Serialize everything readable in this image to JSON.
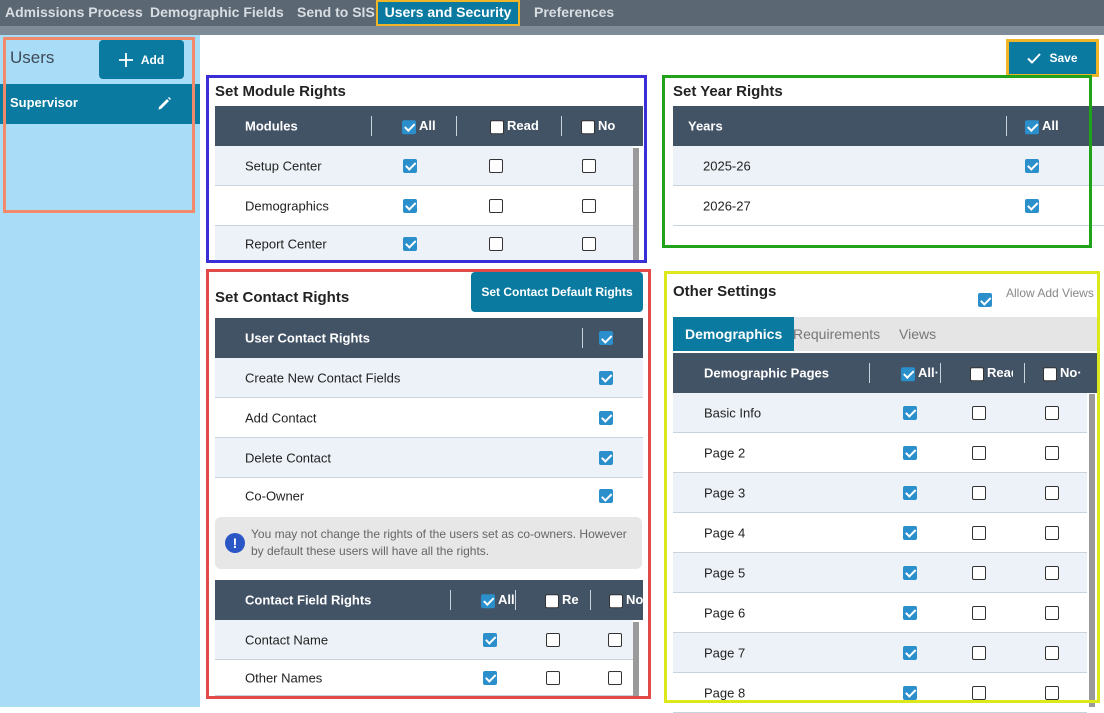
{
  "nav": {
    "tabs": [
      {
        "label": "Admissions Process"
      },
      {
        "label": "Demographic Fields"
      },
      {
        "label": "Send to SIS"
      },
      {
        "label": "Users and Security"
      },
      {
        "label": "Preferences"
      }
    ],
    "active_tab": "Users and Security"
  },
  "sidebar": {
    "title": "Users",
    "add_label": "Add",
    "users": [
      {
        "name": "Supervisor"
      }
    ]
  },
  "toolbar": {
    "save_label": "Save"
  },
  "module_rights": {
    "title": "Set Module Rights",
    "headers": {
      "name": "Modules",
      "all": "All",
      "read": "Read",
      "no": "No"
    },
    "header_checked": {
      "all": true,
      "read": false,
      "no": false
    },
    "rows": [
      {
        "name": "Setup Center",
        "all": true,
        "read": false,
        "no": false
      },
      {
        "name": "Demographics",
        "all": true,
        "read": false,
        "no": false
      },
      {
        "name": "Report Center",
        "all": true,
        "read": false,
        "no": false
      }
    ]
  },
  "year_rights": {
    "title": "Set Year Rights",
    "headers": {
      "name": "Years",
      "all": "All"
    },
    "header_checked": {
      "all": true
    },
    "rows": [
      {
        "name": "2025-26",
        "checked": true
      },
      {
        "name": "2026-27",
        "checked": true
      }
    ]
  },
  "contact_rights": {
    "title": "Set Contact Rights",
    "default_button": "Set Contact Default Rights",
    "user_rights_header": "User Contact Rights",
    "user_rights_header_checked": true,
    "user_rights": [
      {
        "name": "Create New Contact Fields",
        "checked": true
      },
      {
        "name": "Add Contact",
        "checked": true
      },
      {
        "name": "Delete Contact",
        "checked": true
      },
      {
        "name": "Co-Owner",
        "checked": true
      }
    ],
    "note": "You may not change the rights of the users set as co-owners. However by default these users will have all the rights.",
    "field_rights_headers": {
      "name": "Contact Field Rights",
      "all": "All",
      "read": "Re",
      "no": "No"
    },
    "field_rights_header_checked": {
      "all": true,
      "read": false,
      "no": false
    },
    "field_rights": [
      {
        "name": "Contact Name",
        "all": true,
        "read": false,
        "no": false
      },
      {
        "name": "Other Names",
        "all": true,
        "read": false,
        "no": false
      }
    ]
  },
  "other_settings": {
    "title": "Other Settings",
    "allow_add_views_label": "Allow Add Views",
    "allow_add_views_checked": true,
    "tabs": [
      {
        "label": "Demographics"
      },
      {
        "label": "Requirements"
      },
      {
        "label": "Views"
      }
    ],
    "active_tab": "Demographics",
    "headers": {
      "name": "Demographic Pages",
      "all": "All·",
      "read": "Read",
      "no": "No·"
    },
    "header_checked": {
      "all": true,
      "read": false,
      "no": false
    },
    "pages": [
      {
        "name": "Basic Info",
        "all": true,
        "read": false,
        "no": false
      },
      {
        "name": "Page 2",
        "all": true,
        "read": false,
        "no": false
      },
      {
        "name": "Page 3",
        "all": true,
        "read": false,
        "no": false
      },
      {
        "name": "Page 4",
        "all": true,
        "read": false,
        "no": false
      },
      {
        "name": "Page 5",
        "all": true,
        "read": false,
        "no": false
      },
      {
        "name": "Page 6",
        "all": true,
        "read": false,
        "no": false
      },
      {
        "name": "Page 7",
        "all": true,
        "read": false,
        "no": false
      },
      {
        "name": "Page 8",
        "all": true,
        "read": false,
        "no": false
      }
    ]
  },
  "colors": {
    "accent": "#0a7aa0",
    "header_bg": "#435366",
    "sidebar_bg": "#a9dcf7",
    "check": "#2a8fcb",
    "highlight_orange": "#f0b429",
    "box_blue": "#3a2fd6",
    "box_green": "#21a319",
    "box_red": "#e24a4a",
    "box_yellow": "#dce81c",
    "box_salmon": "#f08a6a"
  }
}
